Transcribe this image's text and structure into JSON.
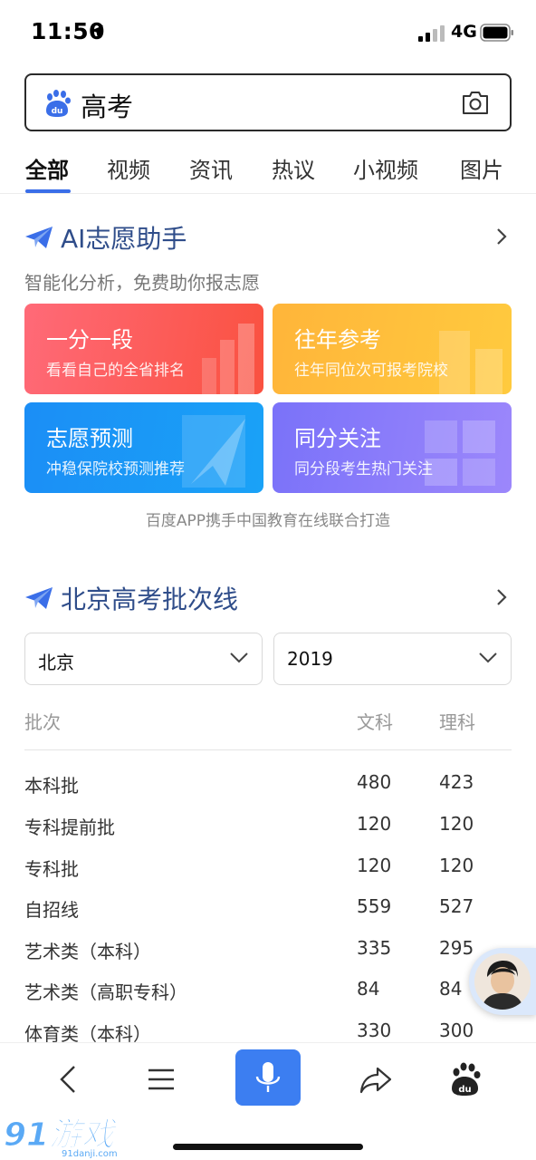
{
  "status_bar": {
    "time": "11:50",
    "network": "4G"
  },
  "search": {
    "query": "高考"
  },
  "tabs": [
    {
      "label": "全部",
      "active": true
    },
    {
      "label": "视频"
    },
    {
      "label": "资讯"
    },
    {
      "label": "热议"
    },
    {
      "label": "小视频"
    },
    {
      "label": "图片"
    }
  ],
  "assistant": {
    "title": "AI志愿助手",
    "subtitle": "智能化分析，免费助你报志愿",
    "cards": [
      {
        "title": "一分一段",
        "subtitle": "看看自己的全省排名"
      },
      {
        "title": "往年参考",
        "subtitle": "往年同位次可报考院校"
      },
      {
        "title": "志愿预测",
        "subtitle": "冲稳保院校预测推荐"
      },
      {
        "title": "同分关注",
        "subtitle": "同分段考生热门关注"
      }
    ],
    "credit": "百度APP携手中国教育在线联合打造"
  },
  "batch_lines": {
    "title": "北京高考批次线",
    "region_select": "北京",
    "year_select": "2019",
    "columns": {
      "batch": "批次",
      "wen": "文科",
      "li": "理科"
    },
    "rows": [
      {
        "batch": "本科批",
        "wen": "480",
        "li": "423"
      },
      {
        "batch": "专科提前批",
        "wen": "120",
        "li": "120"
      },
      {
        "batch": "专科批",
        "wen": "120",
        "li": "120"
      },
      {
        "batch": "自招线",
        "wen": "559",
        "li": "527"
      },
      {
        "batch": "艺术类（本科）",
        "wen": "335",
        "li": "295"
      },
      {
        "batch": "艺术类（高职专科）",
        "wen": "84",
        "li": "84"
      },
      {
        "batch": "体育类（本科）",
        "wen": "330",
        "li": "300"
      }
    ]
  },
  "watermark": {
    "brand": "91游戏",
    "site": "91danji.com"
  },
  "colors": {
    "accent": "#3a6ee8",
    "section_title": "#2f4d8a",
    "mic": "#3c7ef1"
  },
  "icons": {
    "bottom_nav": [
      "back-icon",
      "menu-icon",
      "mic-icon",
      "share-icon",
      "baidu-paw-icon"
    ]
  }
}
